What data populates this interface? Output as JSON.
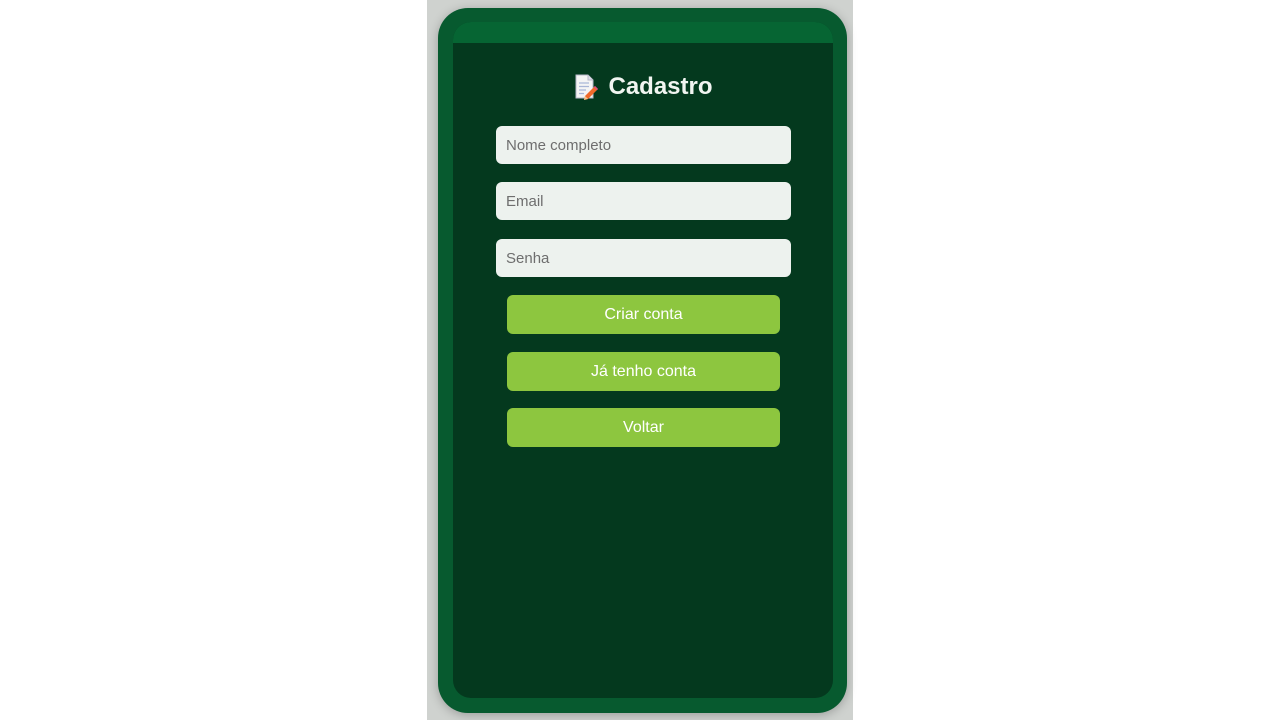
{
  "form": {
    "title": "Cadastro",
    "title_icon": "memo-icon",
    "name_placeholder": "Nome completo",
    "email_placeholder": "Email",
    "password_placeholder": "Senha",
    "create_label": "Criar conta",
    "have_account_label": "Já tenho conta",
    "back_label": "Voltar"
  },
  "colors": {
    "frame": "#075a2f",
    "screen": "#04391e",
    "status_bar": "#066533",
    "button": "#8dc63f",
    "input_bg": "#edf2ee"
  }
}
